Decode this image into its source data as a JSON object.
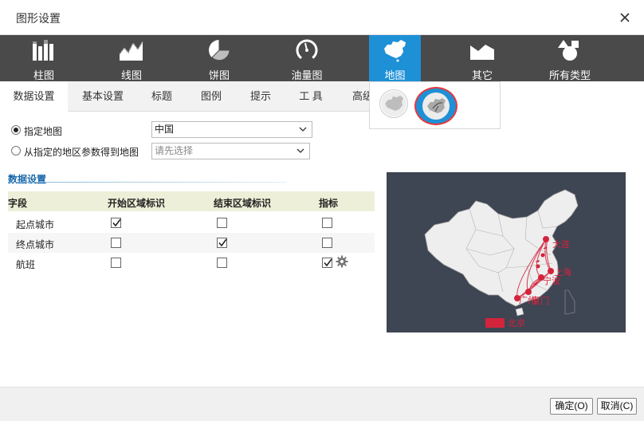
{
  "window": {
    "title": "图形设置"
  },
  "chart_types": [
    {
      "label": "柱图",
      "icon": "bar-chart-icon"
    },
    {
      "label": "线图",
      "icon": "line-chart-icon"
    },
    {
      "label": "饼图",
      "icon": "pie-chart-icon"
    },
    {
      "label": "油量图",
      "icon": "gauge-icon"
    },
    {
      "label": "地图",
      "icon": "map-china-icon",
      "active": true
    },
    {
      "label": "其它",
      "icon": "area-shape-icon"
    },
    {
      "label": "所有类型",
      "icon": "shapes-icon"
    }
  ],
  "map_subtypes": [
    {
      "name": "region-map",
      "selected": false
    },
    {
      "name": "flow-map",
      "selected": true
    }
  ],
  "tabs": [
    "数据设置",
    "基本设置",
    "标题",
    "图例",
    "提示",
    "工 具",
    "高级"
  ],
  "active_tab": "数据设置",
  "map_source": {
    "option_specified_label": "指定地图",
    "option_specified_selected": true,
    "specified_value": "中国",
    "option_param_label": "从指定的地区参数得到地图",
    "param_placeholder": "请先选择"
  },
  "data_settings": {
    "section_title": "数据设置",
    "columns": [
      "字段",
      "开始区域标识",
      "结束区域标识",
      "指标"
    ],
    "rows": [
      {
        "field": "起点城市",
        "start": true,
        "end": false,
        "metric": false
      },
      {
        "field": "终点城市",
        "start": false,
        "end": true,
        "metric": false
      },
      {
        "field": "航班",
        "start": false,
        "end": false,
        "metric": true,
        "has_settings": true
      }
    ]
  },
  "preview": {
    "cities": [
      "大连",
      "上海",
      "宁波",
      "厦门",
      "广州"
    ],
    "legend": "北京",
    "accent_color": "#d3243c",
    "background": "#3e4553"
  },
  "footer": {
    "ok_label": "确定(O)",
    "cancel_label": "取消(C)"
  }
}
